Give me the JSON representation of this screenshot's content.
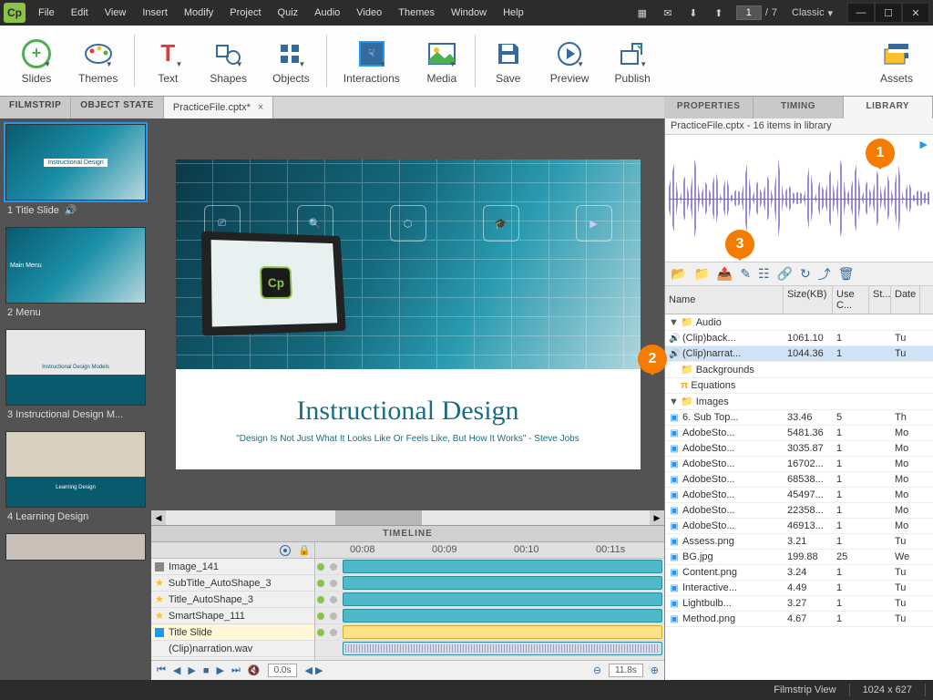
{
  "titlebar": {
    "logo": "Cp",
    "menu": [
      "File",
      "Edit",
      "View",
      "Insert",
      "Modify",
      "Project",
      "Quiz",
      "Audio",
      "Video",
      "Themes",
      "Window",
      "Help"
    ],
    "page_current": "1",
    "page_total": "7",
    "layout": "Classic"
  },
  "ribbon": [
    {
      "id": "slides",
      "label": "Slides"
    },
    {
      "id": "themes",
      "label": "Themes"
    },
    {
      "id": "text",
      "label": "Text"
    },
    {
      "id": "shapes",
      "label": "Shapes"
    },
    {
      "id": "objects",
      "label": "Objects"
    },
    {
      "id": "interactions",
      "label": "Interactions"
    },
    {
      "id": "media",
      "label": "Media"
    },
    {
      "id": "save",
      "label": "Save"
    },
    {
      "id": "preview",
      "label": "Preview"
    },
    {
      "id": "publish",
      "label": "Publish"
    },
    {
      "id": "assets",
      "label": "Assets"
    }
  ],
  "doc_tabs": {
    "filmstrip": "FILMSTRIP",
    "objstate": "OBJECT STATE",
    "file": "PracticeFile.cptx*"
  },
  "filmstrip": [
    {
      "label": "1 Title Slide",
      "audio": true,
      "selected": true
    },
    {
      "label": "2 Menu"
    },
    {
      "label": "3 Instructional Design M..."
    },
    {
      "label": "4 Learning Design"
    }
  ],
  "slide": {
    "title": "Instructional Design",
    "subtitle": "\"Design Is Not Just What It Looks Like Or Feels Like, But How It Works\" - Steve Jobs"
  },
  "timeline": {
    "title": "TIMELINE",
    "ruler": [
      "00:08",
      "00:09",
      "00:10",
      "00:11s"
    ],
    "rows": [
      {
        "icon": "img",
        "name": "Image_141"
      },
      {
        "icon": "star",
        "name": "SubTitle_AutoShape_3"
      },
      {
        "icon": "star",
        "name": "Title_AutoShape_3"
      },
      {
        "icon": "star",
        "name": "SmartShape_111"
      },
      {
        "icon": "sq",
        "name": "Title Slide",
        "selected": true
      },
      {
        "icon": "",
        "name": "(Clip)narration.wav",
        "audio": true
      }
    ],
    "time_start": "0.0s",
    "time_end": "11.8s"
  },
  "rightpanel": {
    "tabs": {
      "props": "PROPERTIES",
      "timing": "TIMING",
      "library": "LIBRARY"
    },
    "library_info": "PracticeFile.cptx - 16 items in library",
    "columns": {
      "name": "Name",
      "size": "Size(KB)",
      "use": "Use C...",
      "st": "St...",
      "date": "Date"
    },
    "tree": [
      {
        "type": "folder",
        "name": "Audio",
        "expanded": true,
        "children": [
          {
            "type": "audio",
            "name": "(Clip)back...",
            "size": "1061.10",
            "use": "1",
            "date": "Tu"
          },
          {
            "type": "audio",
            "name": "(Clip)narrat...",
            "size": "1044.36",
            "use": "1",
            "date": "Tu",
            "selected": true
          }
        ]
      },
      {
        "type": "folder",
        "name": "Backgrounds"
      },
      {
        "type": "folder",
        "name": "Equations",
        "iconColor": "#f5a623",
        "mathIcon": true
      },
      {
        "type": "folder",
        "name": "Images",
        "expanded": true,
        "children": [
          {
            "type": "image",
            "name": "6. Sub Top...",
            "size": "33.46",
            "use": "5",
            "date": "Th"
          },
          {
            "type": "image",
            "name": "AdobeSto...",
            "size": "5481.36",
            "use": "1",
            "date": "Mo"
          },
          {
            "type": "image",
            "name": "AdobeSto...",
            "size": "3035.87",
            "use": "1",
            "date": "Mo"
          },
          {
            "type": "image",
            "name": "AdobeSto...",
            "size": "16702...",
            "use": "1",
            "date": "Mo"
          },
          {
            "type": "image",
            "name": "AdobeSto...",
            "size": "68538...",
            "use": "1",
            "date": "Mo"
          },
          {
            "type": "image",
            "name": "AdobeSto...",
            "size": "45497...",
            "use": "1",
            "date": "Mo"
          },
          {
            "type": "image",
            "name": "AdobeSto...",
            "size": "22358...",
            "use": "1",
            "date": "Mo"
          },
          {
            "type": "image",
            "name": "AdobeSto...",
            "size": "46913...",
            "use": "1",
            "date": "Mo"
          },
          {
            "type": "image",
            "name": "Assess.png",
            "size": "3.21",
            "use": "1",
            "date": "Tu"
          },
          {
            "type": "image",
            "name": "BG.jpg",
            "size": "199.88",
            "use": "25",
            "date": "We"
          },
          {
            "type": "image",
            "name": "Content.png",
            "size": "3.24",
            "use": "1",
            "date": "Tu"
          },
          {
            "type": "image",
            "name": "Interactive...",
            "size": "4.49",
            "use": "1",
            "date": "Tu"
          },
          {
            "type": "image",
            "name": "Lightbulb...",
            "size": "3.27",
            "use": "1",
            "date": "Tu"
          },
          {
            "type": "image",
            "name": "Method.png",
            "size": "4.67",
            "use": "1",
            "date": "Tu"
          }
        ]
      }
    ]
  },
  "statusbar": {
    "view": "Filmstrip View",
    "dims": "1024 x 627"
  },
  "callouts": {
    "c1": "1",
    "c2": "2",
    "c3": "3"
  }
}
